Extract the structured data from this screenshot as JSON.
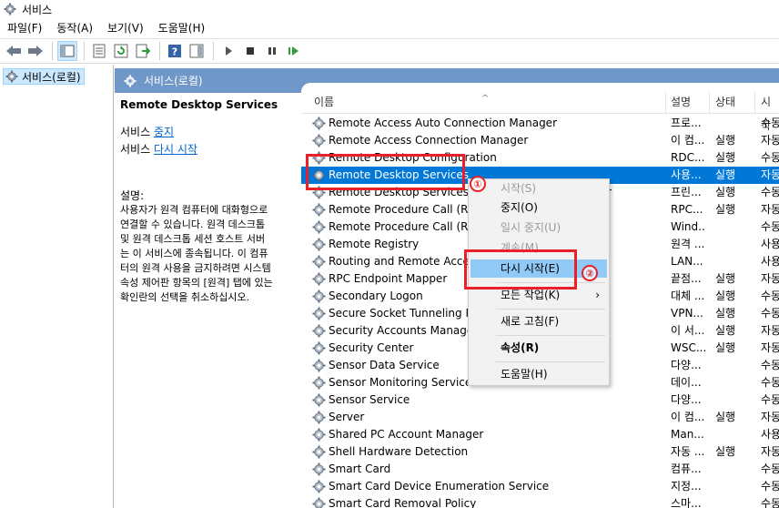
{
  "window": {
    "title": "서비스"
  },
  "menu": {
    "items": [
      "파일(F)",
      "동작(A)",
      "보기(V)",
      "도움말(H)"
    ]
  },
  "tree": {
    "root_label": "서비스(로컬)"
  },
  "pane_header": {
    "label": "서비스(로컬)"
  },
  "description_panel": {
    "service_name": "Remote Desktop Services",
    "stop_prefix": "서비스 ",
    "stop_link": "중지",
    "restart_prefix": "서비스 ",
    "restart_link": "다시 시작",
    "desc_label": "설명:",
    "desc_text": "사용자가 원격 컴퓨터에 대화형으로\n연결할 수 있습니다. 원격 데스크톱\n및 원격 데스크톱 세션 호스트 서버\n는 이 서비스에 종속됩니다. 이 컴퓨\n터의 원격 사용을 금지하려면 시스템\n속성 제어판 항목의 [원격] 탭에 있는\n확인란의 선택을 취소하십시오."
  },
  "list": {
    "columns": {
      "name": "이름",
      "description": "설명",
      "status": "상태",
      "startup": "시작"
    },
    "rows": [
      {
        "name": "Remote Access Auto Connection Manager",
        "description": "프로...",
        "status": "",
        "startup": "수동"
      },
      {
        "name": "Remote Access Connection Manager",
        "description": "이 컴...",
        "status": "실행",
        "startup": "자동"
      },
      {
        "name": "Remote Desktop Configuration",
        "description": "RDC...",
        "status": "실행",
        "startup": "수동"
      },
      {
        "name": "Remote Desktop Services",
        "description": "사용...",
        "status": "실행",
        "startup": "자동"
      },
      {
        "name": "Remote Desktop Services UserMode Port Redirector",
        "description": "프린...",
        "status": "실행",
        "startup": "수동"
      },
      {
        "name": "Remote Procedure Call (RPC)",
        "description": "RPC...",
        "status": "실행",
        "startup": "자동"
      },
      {
        "name": "Remote Procedure Call (RPC) Locator",
        "description": "Wind...",
        "status": "",
        "startup": "수동"
      },
      {
        "name": "Remote Registry",
        "description": "원격 ...",
        "status": "",
        "startup": "사용"
      },
      {
        "name": "Routing and Remote Access",
        "description": "LAN...",
        "status": "",
        "startup": "사용"
      },
      {
        "name": "RPC Endpoint Mapper",
        "description": "끝점...",
        "status": "실행",
        "startup": "자동"
      },
      {
        "name": "Secondary Logon",
        "description": "대체 ...",
        "status": "실행",
        "startup": "수동"
      },
      {
        "name": "Secure Socket Tunneling Protocol Service",
        "description": "VPN...",
        "status": "실행",
        "startup": "수동"
      },
      {
        "name": "Security Accounts Manager",
        "description": "이 서...",
        "status": "실행",
        "startup": "자동"
      },
      {
        "name": "Security Center",
        "description": "WSC...",
        "status": "실행",
        "startup": "자동"
      },
      {
        "name": "Sensor Data Service",
        "description": "다양...",
        "status": "",
        "startup": "수동"
      },
      {
        "name": "Sensor Monitoring Service",
        "description": "데이...",
        "status": "",
        "startup": "수동"
      },
      {
        "name": "Sensor Service",
        "description": "다양...",
        "status": "",
        "startup": "수동"
      },
      {
        "name": "Server",
        "description": "이 컴...",
        "status": "실행",
        "startup": "자동"
      },
      {
        "name": "Shared PC Account Manager",
        "description": "Man...",
        "status": "",
        "startup": "사용"
      },
      {
        "name": "Shell Hardware Detection",
        "description": "자동 ...",
        "status": "실행",
        "startup": "자동"
      },
      {
        "name": "Smart Card",
        "description": "컴퓨...",
        "status": "",
        "startup": "수동"
      },
      {
        "name": "Smart Card Device Enumeration Service",
        "description": "지정...",
        "status": "",
        "startup": "수동"
      },
      {
        "name": "Smart Card Removal Policy",
        "description": "스마...",
        "status": "",
        "startup": "수동"
      }
    ]
  },
  "context_menu": {
    "items": [
      {
        "label": "시작(S)",
        "disabled": true
      },
      {
        "label": "중지(O)",
        "disabled": false
      },
      {
        "label": "일시 중지(U)",
        "disabled": true
      },
      {
        "label": "계속(M)",
        "disabled": true
      },
      {
        "label": "다시 시작(E)",
        "disabled": false
      },
      {
        "label": "모든 작업(K)",
        "disabled": false
      },
      {
        "label": "새로 고침(F)",
        "disabled": false
      },
      {
        "label": "속성(R)",
        "disabled": false
      },
      {
        "label": "도움말(H)",
        "disabled": false
      }
    ]
  },
  "annotations": {
    "step1": "①",
    "step2": "②"
  },
  "colors": {
    "selection": "#0078d7",
    "pane_header": "#6f97c7",
    "annotation": "#e8202a",
    "hover": "#91c9f7"
  }
}
